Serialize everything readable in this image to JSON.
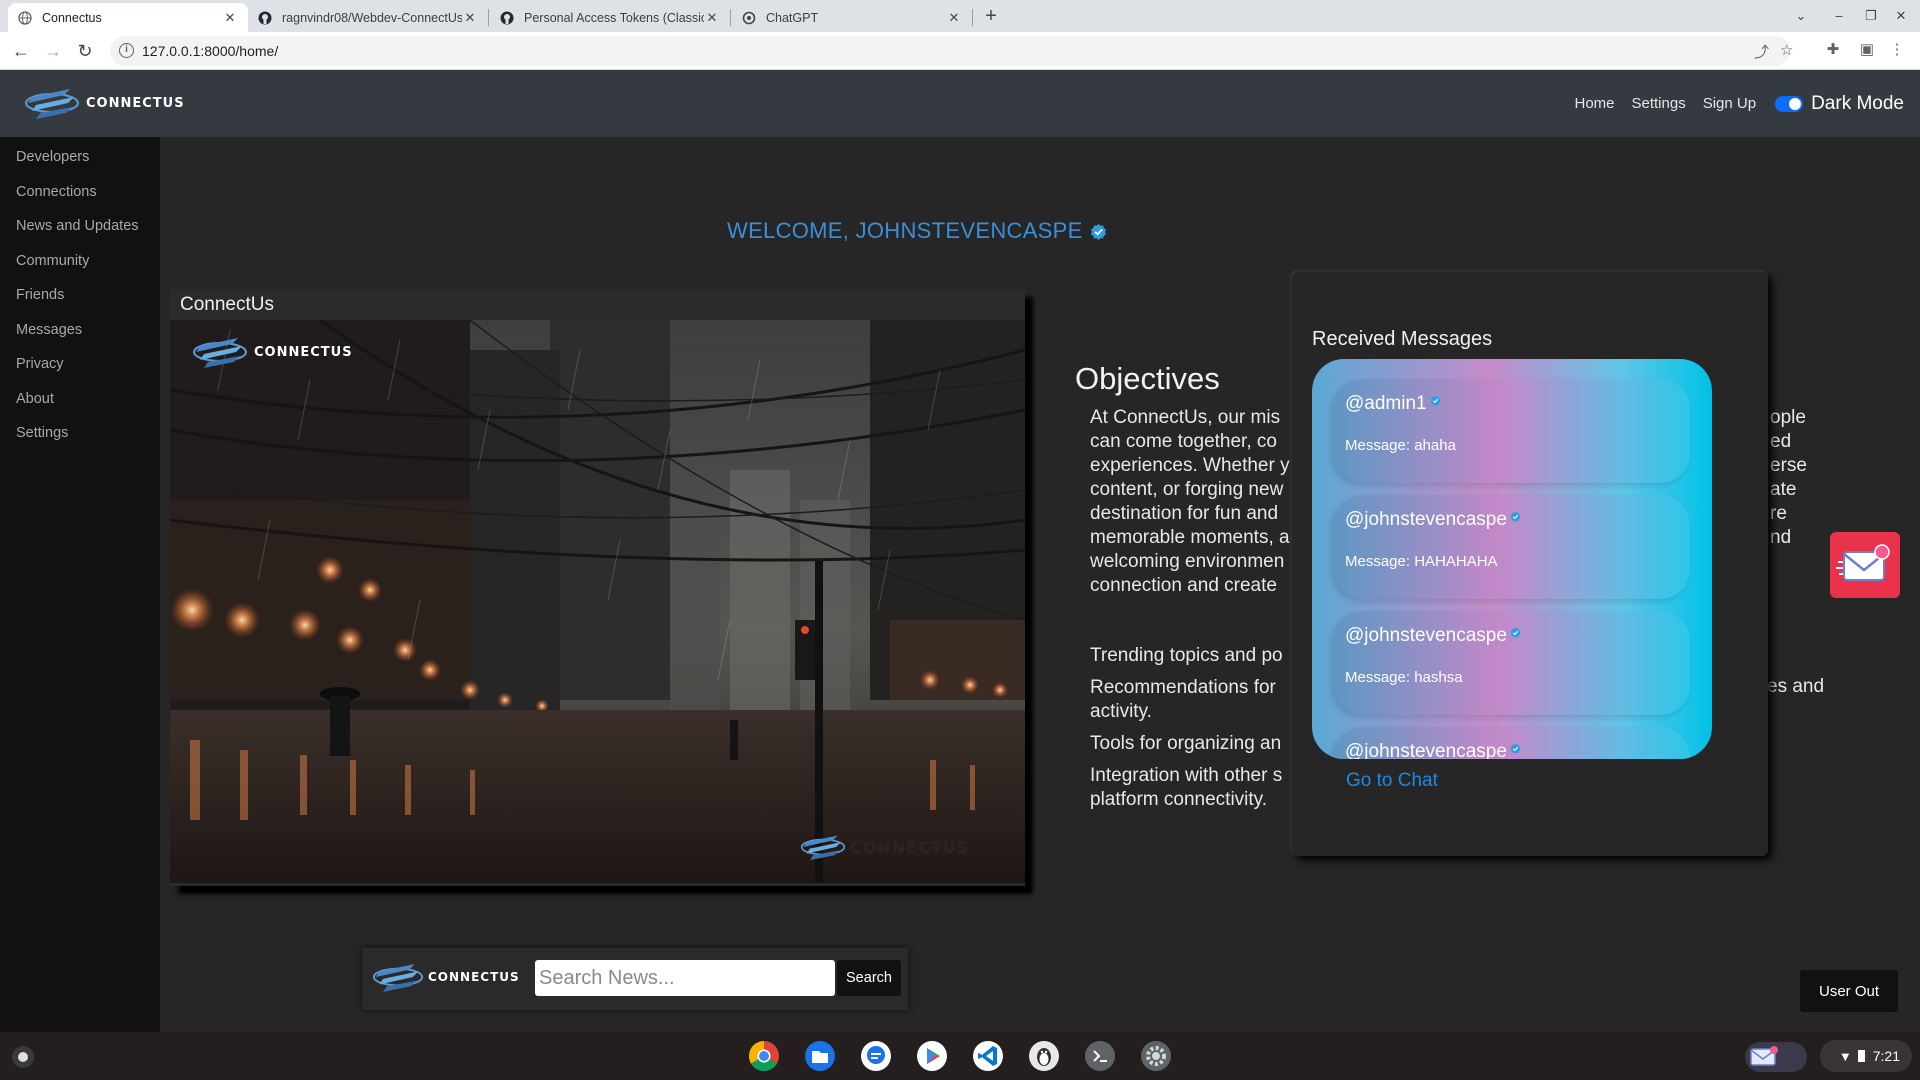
{
  "browser": {
    "tabs": [
      {
        "title": "Connectus",
        "favicon": "globe-icon",
        "active": true
      },
      {
        "title": "ragnvindr08/Webdev-ConnectUs",
        "favicon": "github-icon",
        "active": false
      },
      {
        "title": "Personal Access Tokens (Classic)",
        "favicon": "github-icon",
        "active": false
      },
      {
        "title": "ChatGPT",
        "favicon": "openai-icon",
        "active": false
      }
    ],
    "url": "127.0.0.1:8000/home/"
  },
  "navbar": {
    "brand": "CONNECTUS",
    "links": [
      "Home",
      "Settings",
      "Sign Up"
    ],
    "dark_mode_label": "Dark Mode",
    "dark_mode_on": true
  },
  "sidebar": {
    "items": [
      "Developers",
      "Connections",
      "News and Updates",
      "Community",
      "Friends",
      "Messages",
      "Privacy",
      "About",
      "Settings"
    ]
  },
  "main": {
    "welcome": "WELCOME, JOHNSTEVENCASPE",
    "card_title": "ConnectUs",
    "card_image_brand": "CONNECTUS",
    "card_image_watermark": "CONNECTUS",
    "objectives_title": "Objectives",
    "objectives_lines": [
      "At ConnectUs, our mis",
      "can come together, co",
      "experiences. Whether y",
      "content, or forging new",
      "destination for fun and",
      "memorable moments, a",
      "welcoming environmen",
      "connection and create"
    ],
    "objectives_right": [
      "ople",
      "ed",
      "erse",
      "ate",
      "re",
      "nd"
    ],
    "features": [
      "Trending topics and po",
      "Recommendations for",
      "activity.",
      "Tools for organizing an",
      "Integration with other s",
      "platform connectivity."
    ],
    "features_right": "es and"
  },
  "messages_panel": {
    "heading": "Received Messages",
    "messages": [
      {
        "user": "@admin1",
        "body": "Message: ahaha"
      },
      {
        "user": "@johnstevencaspe",
        "body": "Message: HAHAHAHA"
      },
      {
        "user": "@johnstevencaspe",
        "body": "Message: hashsa"
      },
      {
        "user": "@johnstevencaspe",
        "body": ""
      }
    ],
    "go_to_chat": "Go to Chat"
  },
  "search": {
    "brand": "CONNECTUS",
    "placeholder": "Search News...",
    "button": "Search"
  },
  "user_out": "User Out",
  "os": {
    "time": "7:21"
  },
  "colors": {
    "accent": "#3a8fd9",
    "navbar": "#343a40",
    "sidebar": "#111111",
    "page_bg": "#262626",
    "link": "#1e88e5",
    "mail_button": "#e8334a"
  }
}
